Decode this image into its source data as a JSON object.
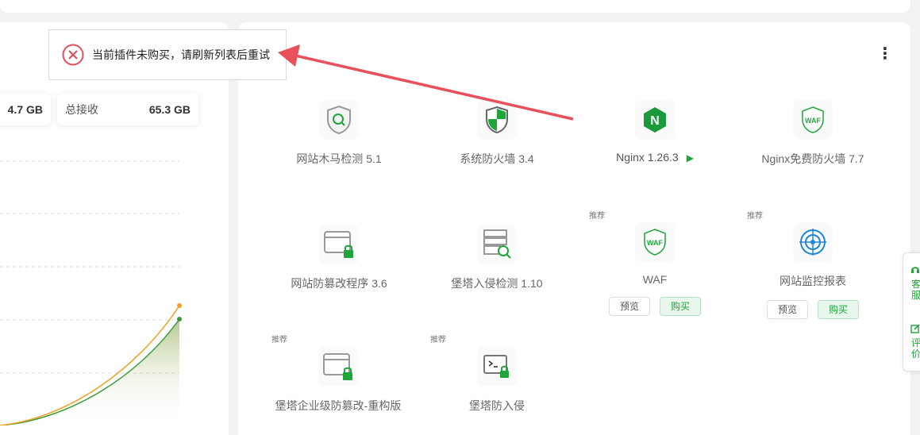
{
  "toast": {
    "message": "当前插件未购买，请刷新列表后重试"
  },
  "stats": {
    "partial_value": "4.7 GB",
    "total_receive_label": "总接收",
    "total_receive_value": "65.3 GB"
  },
  "plugins": [
    {
      "name": "网站木马检测 5.1"
    },
    {
      "name": "系统防火墙 3.4"
    },
    {
      "name": "Nginx 1.26.3"
    },
    {
      "name": "Nginx免费防火墙 7.7"
    },
    {
      "name": "网站防篡改程序 3.6"
    },
    {
      "name": "堡塔入侵检测 1.10"
    },
    {
      "name": "WAF",
      "tag": "推荐",
      "preview": "预览",
      "buy": "购买"
    },
    {
      "name": "网站监控报表",
      "tag": "推荐",
      "preview": "预览",
      "buy": "购买"
    },
    {
      "name": "堡塔企业级防篡改-重构版",
      "tag": "推荐"
    },
    {
      "name": "堡塔防入侵",
      "tag": "推荐"
    }
  ],
  "side": {
    "service": "客服",
    "review": "评价"
  },
  "icons": {
    "waf_label": "WAF",
    "nginx_letter": "N"
  },
  "colors": {
    "accent": "#20a53a",
    "error": "#e0505a",
    "arrow": "#e8505b",
    "line_orange": "#f0a020",
    "line_green": "#3a9a3a"
  }
}
